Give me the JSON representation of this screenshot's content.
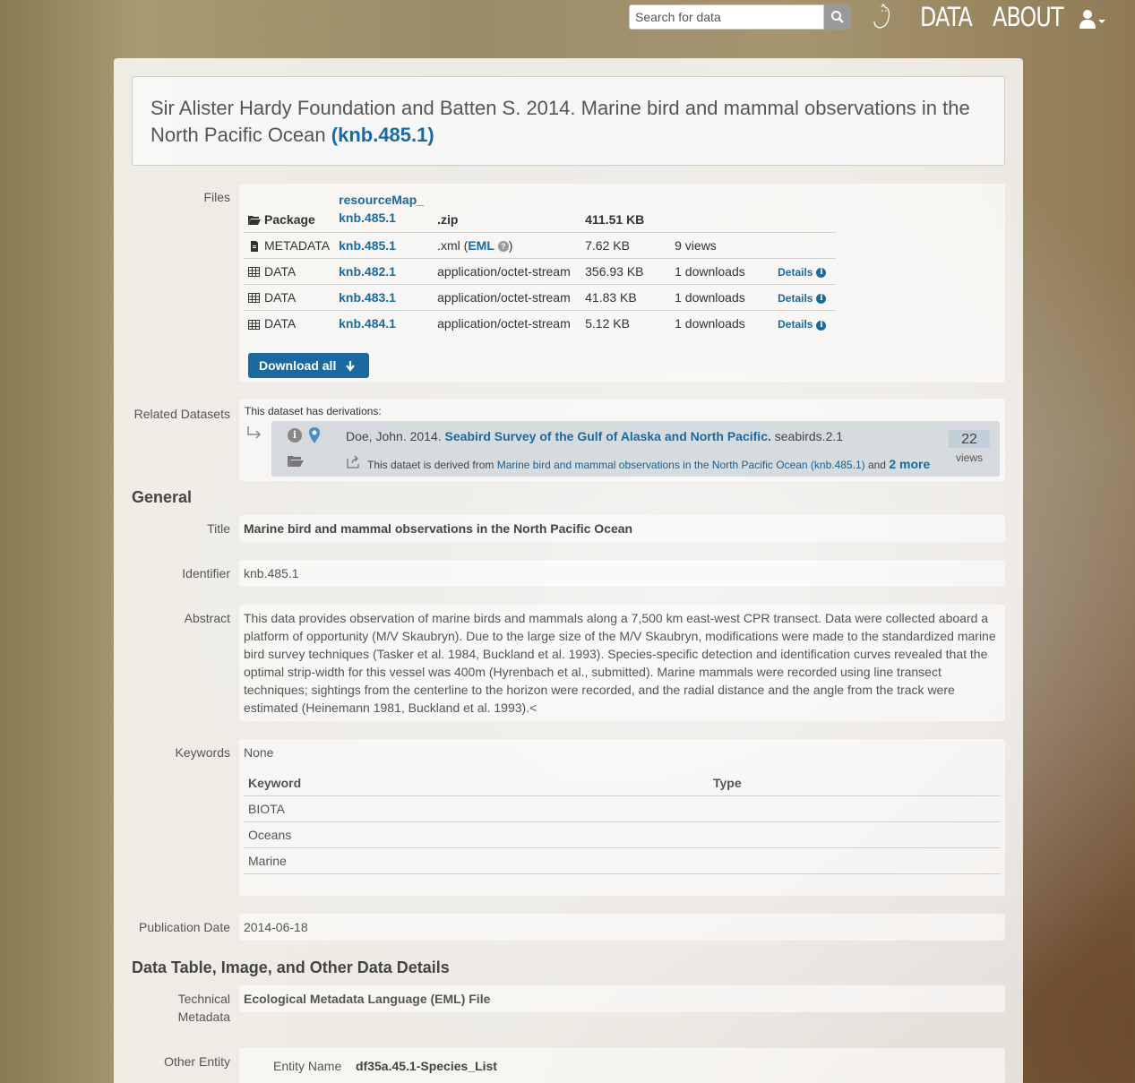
{
  "nav": {
    "search_placeholder": "Search for data",
    "logo_text": "MetaCat",
    "data_label": "DATA",
    "about_label": "ABOUT"
  },
  "citation": {
    "text": "Sir Alister Hardy Foundation and Batten S. 2014. Marine bird and mammal observations in the North Pacific Ocean",
    "pid": "(knb.485.1)"
  },
  "files": {
    "label": "Files",
    "package": {
      "type": "Package",
      "name_line1": "resourceMap_",
      "name_line2": "knb.485.1",
      "format": ".zip",
      "size": "411.51 KB"
    },
    "rows": [
      {
        "type": "METADATA",
        "name": "knb.485.1",
        "format_pre": ".xml (",
        "format_link": "EML",
        "format_post": ")",
        "size": "7.62 KB",
        "stat": "9 views",
        "details": ""
      },
      {
        "type": "DATA",
        "name": "knb.482.1",
        "format": "application/octet-stream",
        "size": "356.93 KB",
        "stat": "1 downloads",
        "details": "Details"
      },
      {
        "type": "DATA",
        "name": "knb.483.1",
        "format": "application/octet-stream",
        "size": "41.83 KB",
        "stat": "1 downloads",
        "details": "Details"
      },
      {
        "type": "DATA",
        "name": "knb.484.1",
        "format": "application/octet-stream",
        "size": "5.12 KB",
        "stat": "1 downloads",
        "details": "Details"
      }
    ],
    "download_all": "Download all"
  },
  "related": {
    "label": "Related Datasets",
    "note": "This dataset has derivations:",
    "author": "Doe, John. 2014.",
    "title": "Seabird Survey of the Gulf of Alaska and North Pacific.",
    "id": "seabirds.2.1",
    "sub_pre": "This dataet is derived from",
    "sub_link": "Marine bird and mammal observations in the North Pacific Ocean (knb.485.1)",
    "sub_and": "and",
    "sub_more": "2 more",
    "views_count": "22",
    "views_label": "views"
  },
  "general": {
    "heading": "General",
    "title_label": "Title",
    "title_value": "Marine bird and mammal observations in the North Pacific Ocean",
    "identifier_label": "Identifier",
    "identifier_value": "knb.485.1",
    "abstract_label": "Abstract",
    "abstract_value": "This data provides observation of marine birds and mammals along a 7,500 km east-west CPR transect. Data were collected aboard a platform of opportunity (M/V Skaubryn). Due to the large size of the M/V Skaubryn, modifications were made to the standardized marine bird survey techniques (Tasker et al. 1984, Buckland et al. 1993). Species-specific detection and identification curves revealed that the optimal strip-width for this vessel was 400m (Hyrenbach et al., submitted). Marine mammals were recorded using line transect techniques; sightings from the centerline to the horizon were recorded, and the radial distance and the angle from the track were estimated (Heinemann 1981, Buckland et al. 1993).<",
    "keywords_label": "Keywords",
    "keywords_value": "None",
    "keyword_headers": [
      "Keyword",
      "Type"
    ],
    "keywords": [
      "BIOTA",
      "Oceans",
      "Marine"
    ],
    "pubdate_label": "Publication Date",
    "pubdate_value": "2014-06-18"
  },
  "details": {
    "heading": "Data Table, Image, and Other Data Details",
    "tech_label_1": "Technical",
    "tech_label_2": "Metadata",
    "tech_value": "Ecological Metadata Language (EML) File",
    "other_label": "Other Entity",
    "entity_name_label": "Entity Name",
    "entity_name_value": "df35a.45.1-Species_List"
  }
}
